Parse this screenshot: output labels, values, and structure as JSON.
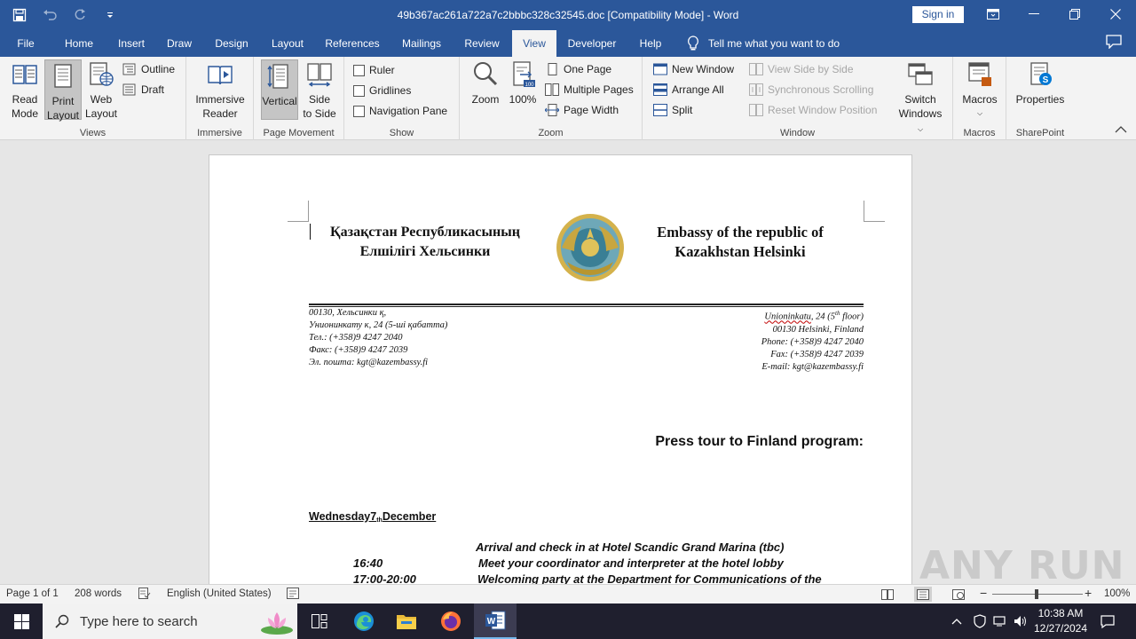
{
  "window": {
    "title": "49b367ac261a722a7c2bbbc328c32545.doc [Compatibility Mode]  -  Word",
    "sign_in": "Sign in"
  },
  "tabs": [
    "File",
    "Home",
    "Insert",
    "Draw",
    "Design",
    "Layout",
    "References",
    "Mailings",
    "Review",
    "View",
    "Developer",
    "Help"
  ],
  "active_tab": "View",
  "tell_me": "Tell me what you want to do",
  "ribbon": {
    "views": {
      "label": "Views",
      "read_mode": [
        "Read",
        "Mode"
      ],
      "print_layout": [
        "Print",
        "Layout"
      ],
      "web_layout": [
        "Web",
        "Layout"
      ],
      "outline": "Outline",
      "draft": "Draft"
    },
    "immersive": {
      "label": "Immersive",
      "reader": [
        "Immersive",
        "Reader"
      ]
    },
    "page_movement": {
      "label": "Page Movement",
      "vertical": "Vertical",
      "side_to_side": [
        "Side",
        "to Side"
      ]
    },
    "show": {
      "label": "Show",
      "ruler": "Ruler",
      "gridlines": "Gridlines",
      "navigation_pane": "Navigation Pane"
    },
    "zoom": {
      "label": "Zoom",
      "zoom": "Zoom",
      "hundred": "100%",
      "one_page": "One Page",
      "multiple_pages": "Multiple Pages",
      "page_width": "Page Width"
    },
    "window": {
      "label": "Window",
      "new_window": "New Window",
      "arrange_all": "Arrange All",
      "split": "Split",
      "view_side_by_side": "View Side by Side",
      "synchronous_scrolling": "Synchronous Scrolling",
      "reset_window_position": "Reset Window Position",
      "switch_windows": [
        "Switch",
        "Windows"
      ]
    },
    "macros": {
      "label": "Macros",
      "macros": "Macros"
    },
    "sharepoint": {
      "label": "SharePoint",
      "properties": "Properties"
    }
  },
  "document": {
    "header_left": [
      "Қазақстан Республикасының",
      "Елшілігі  Хельсинки"
    ],
    "header_right": [
      "Embassy of the republic of",
      "Kazakhstan Helsinki"
    ],
    "address_left": [
      "00130, Хельсинки қ,",
      "Унионинкату к, 24 (5-ші қабатта)",
      "Тел.: (+358)9 4247 2040",
      "Факс: (+358)9 4247 2039",
      "Эл. пошта: kgt@kazembassy.fi"
    ],
    "address_right_line1_street": "Unioninkatu",
    "address_right_line1_rest": ", 24 (5",
    "address_right_line1_sup": "th",
    "address_right_line1_end": " floor)",
    "address_right": [
      "00130 Helsinki, Finland",
      "Phone: (+358)9 4247 2040",
      "Fax: (+358)9 4247 2039",
      "E-mail: kgt@kazembassy.fi"
    ],
    "program_title": "Press tour to Finland program:",
    "day_heading_start": "Wednesday7",
    "day_heading_sub": "th",
    "day_heading_end": "December",
    "schedule": [
      {
        "time": "",
        "text": "Arrival and check in at Hotel Scandic Grand Marina (tbc)"
      },
      {
        "time": "16:40",
        "text": "Meet your coordinator and interpreter at the hotel lobby"
      },
      {
        "time": "17:00-20:00",
        "text": "Welcoming party at the Department for Communications of the"
      }
    ]
  },
  "statusbar": {
    "page": "Page 1 of 1",
    "words": "208 words",
    "language": "English (United States)",
    "zoom": "100%"
  },
  "taskbar": {
    "search_placeholder": "Type here to search",
    "time": "10:38 AM",
    "date": "12/27/2024"
  },
  "watermark": "ANY RUN",
  "colors": {
    "word_blue": "#2b579a",
    "ribbon_bg": "#f3f3f3"
  }
}
